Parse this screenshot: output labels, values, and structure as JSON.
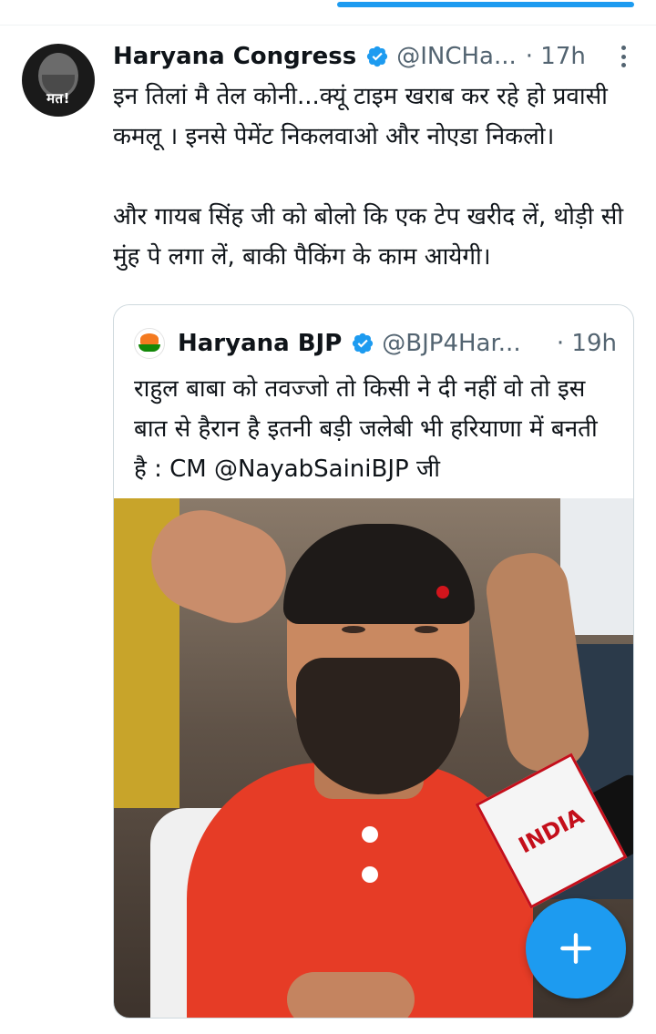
{
  "tweet": {
    "author_name": "Haryana Congress",
    "handle": "@INCHa...",
    "time": "· 17h",
    "avatar_badge": "मत!",
    "text": "इन तिलां मै तेल कोनी...क्यूं टाइम खराब कर रहे हो प्रवासी कमलू । इनसे पेमेंट निकलवाओ और नोएडा निकलो।\n\nऔर गायब सिंह जी को बोलो कि एक टेप खरीद लें, थोड़ी सी मुंह पे लगा लें, बाकी पैकिंग के काम आयेगी।"
  },
  "quote": {
    "author_name": "Haryana BJP",
    "handle": "@BJP4Har...",
    "time": "· 19h",
    "text": "राहुल बाबा को तवज्जो तो किसी ने दी नहीं वो तो इस बात से हैरान है इतनी बड़ी जलेबी भी हरियाणा में बनती है : CM @NayabSainiBJP जी",
    "media_mic_label": "INDIA"
  },
  "colors": {
    "accent": "#1d9bf0",
    "text_primary": "#0f1419",
    "text_secondary": "#536471",
    "border": "#cfd9de"
  },
  "icons": {
    "verified": "verified-badge-icon",
    "more": "more-options-icon",
    "compose": "plus-icon"
  }
}
